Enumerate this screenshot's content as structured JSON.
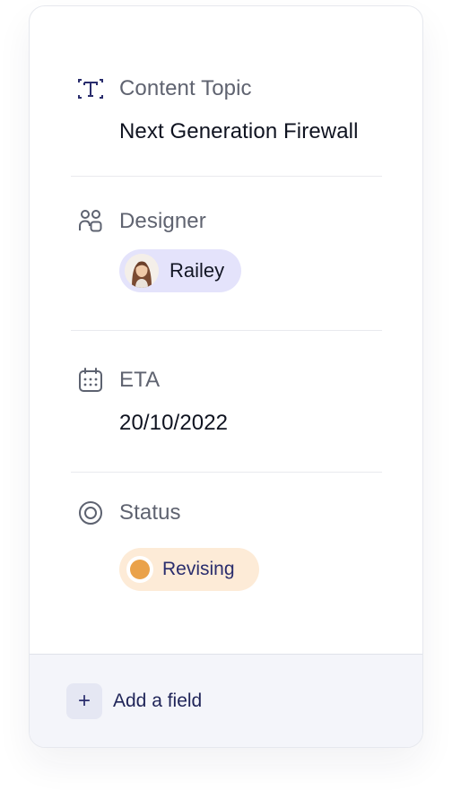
{
  "fields": {
    "content_topic": {
      "label": "Content Topic",
      "value": "Next Generation Firewall",
      "icon": "text-frame-icon"
    },
    "designer": {
      "label": "Designer",
      "value": "Railey",
      "icon": "people-icon"
    },
    "eta": {
      "label": "ETA",
      "value": "20/10/2022",
      "icon": "calendar-icon"
    },
    "status": {
      "label": "Status",
      "value": "Revising",
      "icon": "target-circle-icon",
      "color": "#eaa24a"
    }
  },
  "footer": {
    "add_icon": "+",
    "add_label": "Add a field"
  },
  "colors": {
    "designer_chip": "#e4e3fb",
    "status_chip": "#fdebd7",
    "accent_text": "#2a2d6d"
  }
}
